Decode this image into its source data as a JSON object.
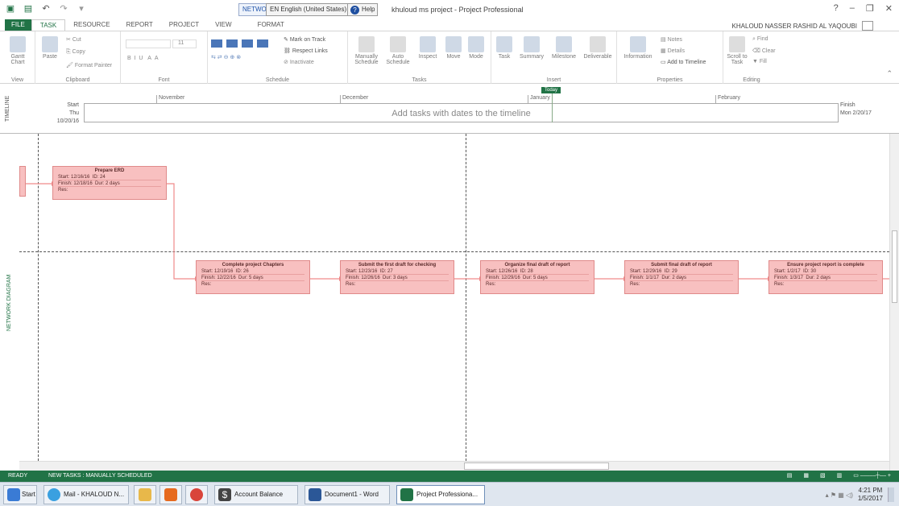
{
  "titlebar": {
    "context_tab": "NETWO",
    "language": "EN English (United States)",
    "help": "Help",
    "app_title": "khuloud ms project - Project Professional",
    "controls": [
      "?",
      "–",
      "❐",
      "✕"
    ]
  },
  "tabs": {
    "file": "FILE",
    "task": "TASK",
    "resource": "RESOURCE",
    "report": "REPORT",
    "project": "PROJECT",
    "view": "VIEW",
    "format": "FORMAT"
  },
  "user": {
    "name": "KHALOUD NASSER RASHID AL YAQOUBI"
  },
  "ribbon": {
    "view_group": {
      "gantt": "Gantt Chart",
      "label": "View"
    },
    "clipboard": {
      "paste": "Paste",
      "cut": "Cut",
      "copy": "Copy",
      "format_painter": "Format Painter",
      "label": "Clipboard"
    },
    "font": {
      "size": "11",
      "label": "Font"
    },
    "schedule": {
      "mark_on_track": "Mark on Track",
      "respect_links": "Respect Links",
      "inactivate": "Inactivate",
      "label": "Schedule"
    },
    "tasks": {
      "manually": "Manually Schedule",
      "auto": "Auto Schedule",
      "inspect": "Inspect",
      "move": "Move",
      "mode": "Mode",
      "label": "Tasks"
    },
    "insert": {
      "task": "Task",
      "summary": "Summary",
      "milestone": "Milestone",
      "deliverable": "Deliverable",
      "label": "Insert"
    },
    "properties": {
      "information": "Information",
      "notes": "Notes",
      "details": "Details",
      "add_to_timeline": "Add to Timeline",
      "label": "Properties"
    },
    "editing": {
      "scroll": "Scroll to Task",
      "find": "Find",
      "clear": "Clear",
      "fill": "Fill",
      "label": "Editing"
    }
  },
  "timeline": {
    "label": "TIMELINE",
    "today": "Today",
    "start_label": "Start",
    "start_date": "Thu 10/20/16",
    "finish_label": "Finish",
    "finish_date": "Mon 2/20/17",
    "hint": "Add tasks with dates to the timeline",
    "months": [
      "November",
      "December",
      "January",
      "February"
    ]
  },
  "network": {
    "label": "NETWORK DIAGRAM",
    "nodes": [
      {
        "title": "Prepare ERD",
        "start": "Start: 12/16/16",
        "id": "ID: 24",
        "finish": "Finish: 12/18/16",
        "dur": "Dur: 2 days",
        "res": "Res:"
      },
      {
        "title": "Complete project Chapters",
        "start": "Start: 12/19/16",
        "id": "ID: 26",
        "finish": "Finish: 12/22/16",
        "dur": "Dur: 5 days",
        "res": "Res:"
      },
      {
        "title": "Submit the first draft for checking",
        "start": "Start: 12/23/16",
        "id": "ID: 27",
        "finish": "Finish: 12/26/16",
        "dur": "Dur: 3 days",
        "res": "Res:"
      },
      {
        "title": "Organize final draft of report",
        "start": "Start: 12/26/16",
        "id": "ID: 28",
        "finish": "Finish: 12/29/16",
        "dur": "Dur: 5 days",
        "res": "Res:"
      },
      {
        "title": "Submit final draft of report",
        "start": "Start: 12/29/16",
        "id": "ID: 29",
        "finish": "Finish: 1/1/17",
        "dur": "Dur: 2 days",
        "res": "Res:"
      },
      {
        "title": "Ensure project report is complete",
        "start": "Start: 1/2/17",
        "id": "ID: 30",
        "finish": "Finish: 1/3/17",
        "dur": "Dur: 2 days",
        "res": "Res:"
      }
    ]
  },
  "status": {
    "ready": "READY",
    "mode": "NEW TASKS : MANUALLY SCHEDULED"
  },
  "taskbar": {
    "start": "Start",
    "mail": "Mail - KHALOUD N...",
    "account": "Account Balance",
    "word": "Document1 - Word",
    "project": "Project Professiona...",
    "time": "4:21 PM",
    "date": "1/5/2017"
  }
}
